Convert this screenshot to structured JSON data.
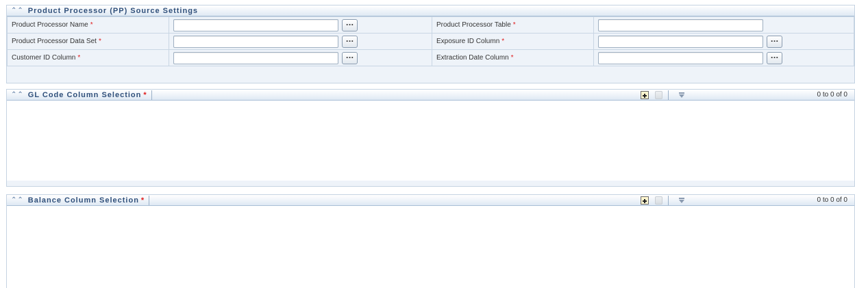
{
  "pp_settings": {
    "title": "Product Processor (PP) Source Settings",
    "fields": [
      {
        "label": "Product Processor Name",
        "required": "*",
        "value": "",
        "has_browse": true
      },
      {
        "label": "Product Processor Table",
        "required": "*",
        "value": "",
        "has_browse": false
      },
      {
        "label": "Product Processor Data Set",
        "required": "*",
        "value": "",
        "has_browse": true
      },
      {
        "label": "Exposure ID Column",
        "required": "*",
        "value": "",
        "has_browse": true
      },
      {
        "label": "Customer ID Column",
        "required": "*",
        "value": "",
        "has_browse": true
      },
      {
        "label": "Extraction Date Column",
        "required": "*",
        "value": "",
        "has_browse": true
      }
    ],
    "browse_label": "..."
  },
  "gl_code": {
    "title": "GL Code Column Selection",
    "required": "*",
    "count": "0 to 0 of 0"
  },
  "balance": {
    "title": "Balance Column Selection",
    "required": "*",
    "count": "0 to 0 of 0"
  },
  "icons": {
    "collapse": "collapse-chevron-icon",
    "add": "add-row-icon",
    "delete": "delete-icon",
    "filter": "filter-icon"
  },
  "colors": {
    "header_text": "#2f4f7a",
    "required": "#e01b1b",
    "panel_bg": "#eef3f9",
    "border": "#c5d3e2"
  }
}
